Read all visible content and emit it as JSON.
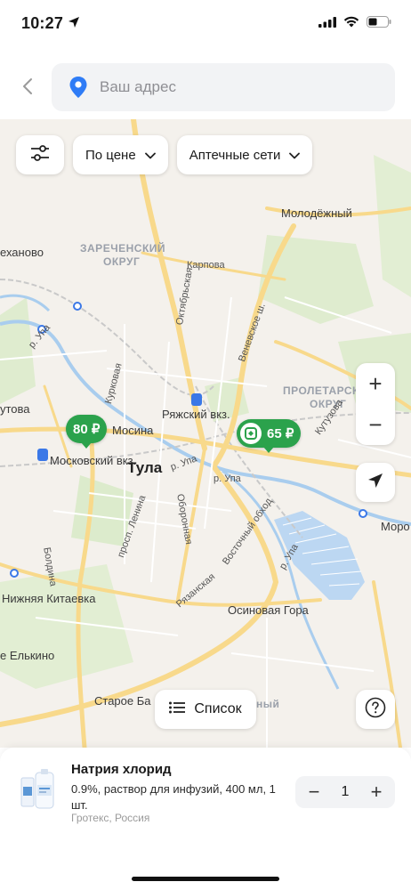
{
  "status_bar": {
    "time": "10:27",
    "icons": [
      "location-arrow-icon",
      "cellular-signal-icon",
      "wifi-icon",
      "battery-icon"
    ]
  },
  "header": {
    "back_icon": "chevron-left-icon",
    "address_placeholder": "Ваш адрес",
    "address_icon": "location-pin-icon",
    "accent_color": "#2f7cf6"
  },
  "filters": {
    "settings_icon": "sliders-icon",
    "price_label": "По цене",
    "networks_label": "Аптечные сети"
  },
  "map": {
    "labels": {
      "molodezhny": "Молодёжный",
      "ehanovo": "еханово",
      "zarechensky": "ЗАРЕЧЕНСКИЙ",
      "okrug1": "ОКРУГ",
      "karpova": "Карпова",
      "oktyabrskaya": "Октябрьская",
      "venevskoe": "Веневское ш.",
      "kurkovaya": "Курковая",
      "ryazhsky": "Ряжский вкз.",
      "proletarsky": "ПРОЛЕТАРСКИЙ",
      "okrug2": "ОКРУГ",
      "mosina": "Мосина",
      "kutuzova": "Кутузова",
      "utova": "утова",
      "moskovsky": "Московский вкз.",
      "tula": "Тула",
      "upa1": "р. Упа",
      "upa2": "р. Упа",
      "upa3": "р. Упа",
      "upa4": "р. Упа",
      "boldina": "Болдина",
      "lenina": "просп. Ленина",
      "oboronnaya": "Оборонная",
      "vostochny": "Восточный обход",
      "ryazanskaya": "Рязанская",
      "moro": "Моро",
      "nizhnyaya": "Нижняя Китаевка",
      "osinovaya": "Осиновая Гора",
      "elkino": "е Елькино",
      "staroe": "Старое Ба",
      "ny": "ный"
    },
    "price_pins": [
      {
        "label": "80 ₽",
        "has_icon": false
      },
      {
        "label": "65 ₽",
        "has_icon": true
      }
    ],
    "pin_color": "#2ba24c",
    "zoom_in": "+",
    "zoom_out": "−",
    "locate_icon": "navigation-arrow-icon",
    "list_label": "Список",
    "list_icon": "list-icon",
    "help_icon": "question-circle-icon"
  },
  "product": {
    "name": "Натрия хлорид",
    "description": "0.9%, раствор для инфузий, 400 мл, 1 шт.",
    "manufacturer": "Гротекс, Россия",
    "quantity": "1",
    "minus": "−",
    "plus": "+"
  }
}
